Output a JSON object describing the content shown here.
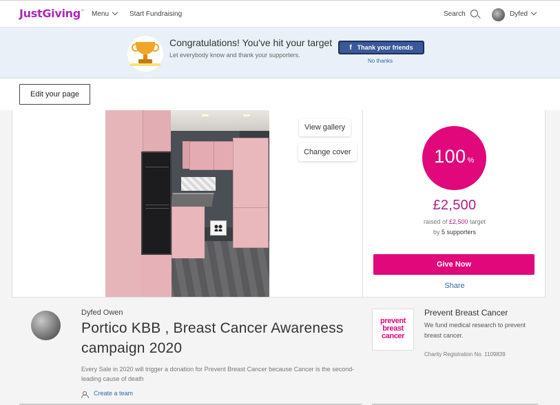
{
  "nav": {
    "logo_text": "JustGiving",
    "logo_mark": "™",
    "menu_label": "Menu",
    "start_fundraising_label": "Start Fundraising",
    "search_label": "Search",
    "username": "Dyfed",
    "brand_color": "#ad29b6"
  },
  "banner": {
    "title": "Congratulations! You've hit your target",
    "subtitle": "Let everybody know and thank your supporters.",
    "facebook_icon": "f",
    "facebook_button_label": "Thank your friends",
    "no_thanks_label": "No thanks",
    "icon": "trophy-icon"
  },
  "edit": {
    "button_label": "Edit your page"
  },
  "cover": {
    "view_gallery_label": "View gallery",
    "change_cover_label": "Change cover"
  },
  "progress": {
    "percent": "100",
    "percent_sign": "%",
    "raised": "£2,500",
    "raised_prefix": "raised of",
    "target": "£2,500",
    "target_suffix": "target",
    "by_prefix": "by",
    "supporters": "5 supporters",
    "give_now_label": "Give Now",
    "share_label": "Share",
    "accent_color": "#e0087b"
  },
  "page": {
    "owner_name": "Dyfed Owen",
    "title": "Portico KBB , Breast Cancer Awareness campaign 2020",
    "story": "Every Sale in 2020 will trigger a donation for Prevent Breast Cancer because Cancer is the second-leading cause of death",
    "create_team_label": "Create a team"
  },
  "charity": {
    "logo_line1": "prevent",
    "logo_line2": "breast",
    "logo_line3": "cancer",
    "name": "Prevent Breast Cancer",
    "description": "We fund medical research to prevent breast cancer.",
    "registration": "Charity Registration No. 1109839"
  }
}
